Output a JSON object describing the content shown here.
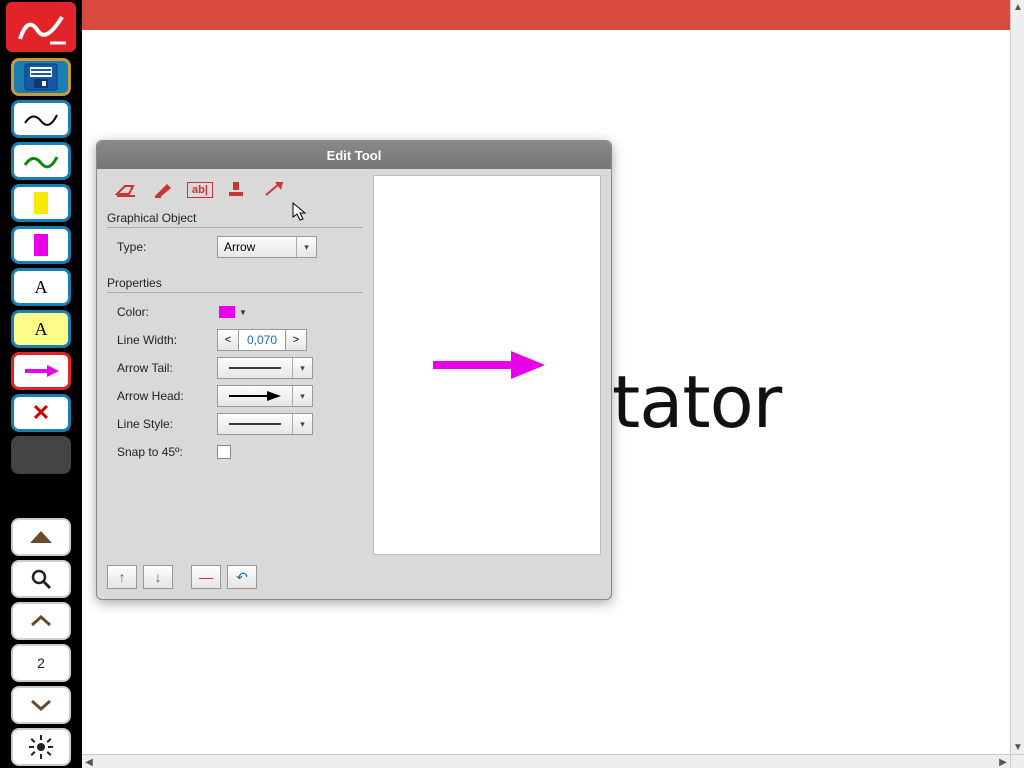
{
  "sidebar": {
    "page_number": "2"
  },
  "canvas": {
    "visible_text": "tator"
  },
  "dialog": {
    "title": "Edit Tool",
    "sections": {
      "graphical_object": "Graphical Object",
      "properties": "Properties"
    },
    "labels": {
      "type": "Type:",
      "color": "Color:",
      "line_width": "Line Width:",
      "arrow_tail": "Arrow Tail:",
      "arrow_head": "Arrow Head:",
      "line_style": "Line Style:",
      "snap": "Snap to 45º:"
    },
    "values": {
      "type": "Arrow",
      "line_width": "0,070",
      "color": "#e800e8",
      "snap_checked": false
    },
    "spinner": {
      "dec": "<",
      "inc": ">"
    },
    "footer": {
      "up": "↑",
      "down": "↓",
      "delete": "—",
      "undo": "↶"
    }
  }
}
